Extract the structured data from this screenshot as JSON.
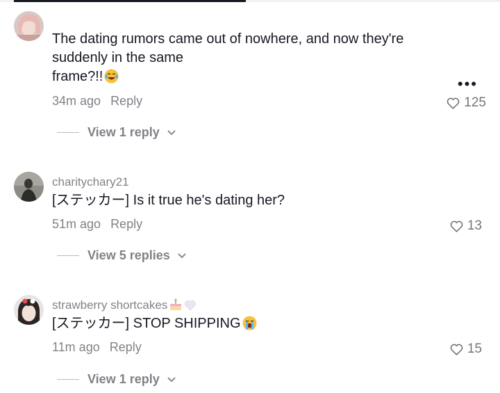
{
  "comments": [
    {
      "username": "",
      "text": "The dating rumors came out of nowhere, and now they're suddenly in the same frame?!!",
      "text_line1": "The dating rumors came out of nowhere, and now they're",
      "text_line2": "suddenly in the same",
      "text_line3": "frame?!!",
      "emoji": "laughing-crying-emoji",
      "time": "34m ago",
      "reply_label": "Reply",
      "likes": "125",
      "view_replies": "View 1 reply",
      "more_label": "•••"
    },
    {
      "username": "charitychary21",
      "text": "[ステッカー] Is it true he's dating her?",
      "time": "51m ago",
      "reply_label": "Reply",
      "likes": "13",
      "view_replies": "View 5 replies"
    },
    {
      "username": "strawberry shortcakes",
      "username_emojis": [
        "cake-emoji",
        "white-heart-emoji"
      ],
      "text": "[ステッカー] STOP SHIPPING",
      "emoji": "crying-emoji",
      "time": "11m ago",
      "reply_label": "Reply",
      "likes": "15",
      "view_replies": "View 1 reply"
    }
  ],
  "colors": {
    "primary_text": "#161823",
    "secondary_text": "#8a8b91",
    "background": "#ffffff"
  }
}
